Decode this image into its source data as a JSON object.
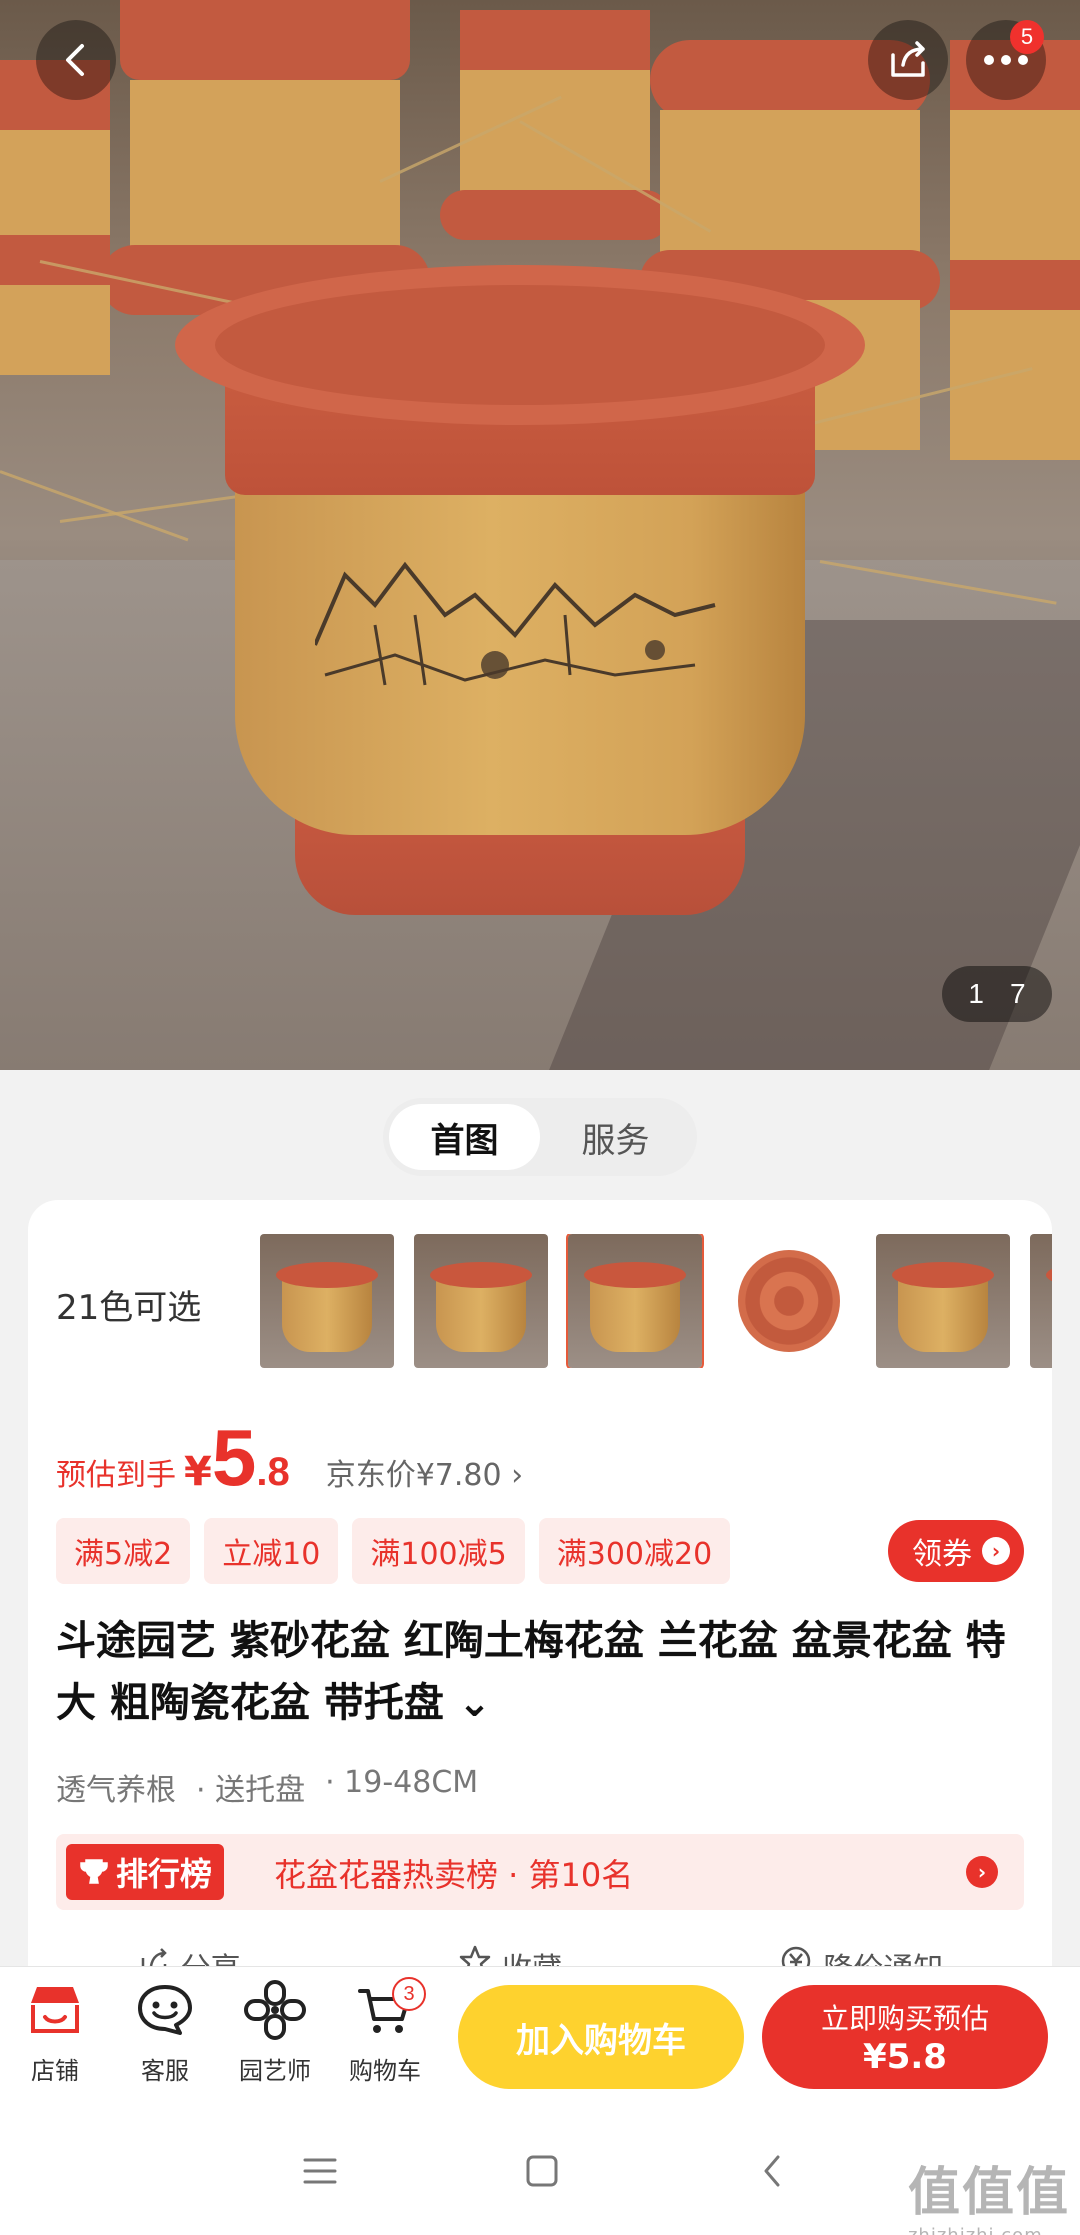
{
  "header": {
    "notification_count": "5",
    "image_counter": {
      "current": "1",
      "total": "7"
    }
  },
  "segment_tabs": [
    {
      "label": "首图",
      "active": true
    },
    {
      "label": "服务",
      "active": false
    }
  ],
  "variants": {
    "label": "21色可选",
    "thumbnails": [
      {
        "type": "pot",
        "selected": false
      },
      {
        "type": "pot",
        "selected": false
      },
      {
        "type": "pot",
        "selected": true
      },
      {
        "type": "tray",
        "selected": false
      },
      {
        "type": "pot",
        "selected": false
      }
    ]
  },
  "price": {
    "prefix": "预估到手",
    "currency": "¥",
    "integer": "5",
    "decimal": ".8",
    "jd_price": "京东价¥7.80 ›"
  },
  "coupons": [
    "满5减2",
    "立减10",
    "满100减5",
    "满300减20"
  ],
  "get_coupon_label": "领券",
  "product": {
    "title": "斗途园艺 紫砂花盆 红陶土梅花盆 兰花盆 盆景花盆 特大 粗陶瓷花盆 带托盘 ⌄",
    "tags": [
      "透气养根",
      "· 送托盘",
      "· 19-48CM"
    ]
  },
  "ranking": {
    "badge": "排行榜",
    "text": "花盆花器热卖榜 · 第10名"
  },
  "actions": [
    {
      "label": "分享",
      "icon": "share-icon"
    },
    {
      "label": "收藏",
      "icon": "star-icon"
    },
    {
      "label": "降价通知",
      "icon": "price-alert-icon"
    }
  ],
  "bottom_nav": [
    {
      "label": "店铺",
      "icon": "store-icon"
    },
    {
      "label": "客服",
      "icon": "chat-face-icon"
    },
    {
      "label": "园艺师",
      "icon": "flower-icon"
    },
    {
      "label": "购物车",
      "icon": "cart-icon",
      "badge": "3"
    }
  ],
  "buttons": {
    "add_to_cart": "加入购物车",
    "buy_now_line1": "立即购买预估",
    "buy_now_line2": "¥5.8"
  },
  "watermark": {
    "main": "值值值",
    "sub": "zhizhizhi.com"
  },
  "colors": {
    "accent": "#e8322b",
    "cart_button": "#fed22e"
  }
}
